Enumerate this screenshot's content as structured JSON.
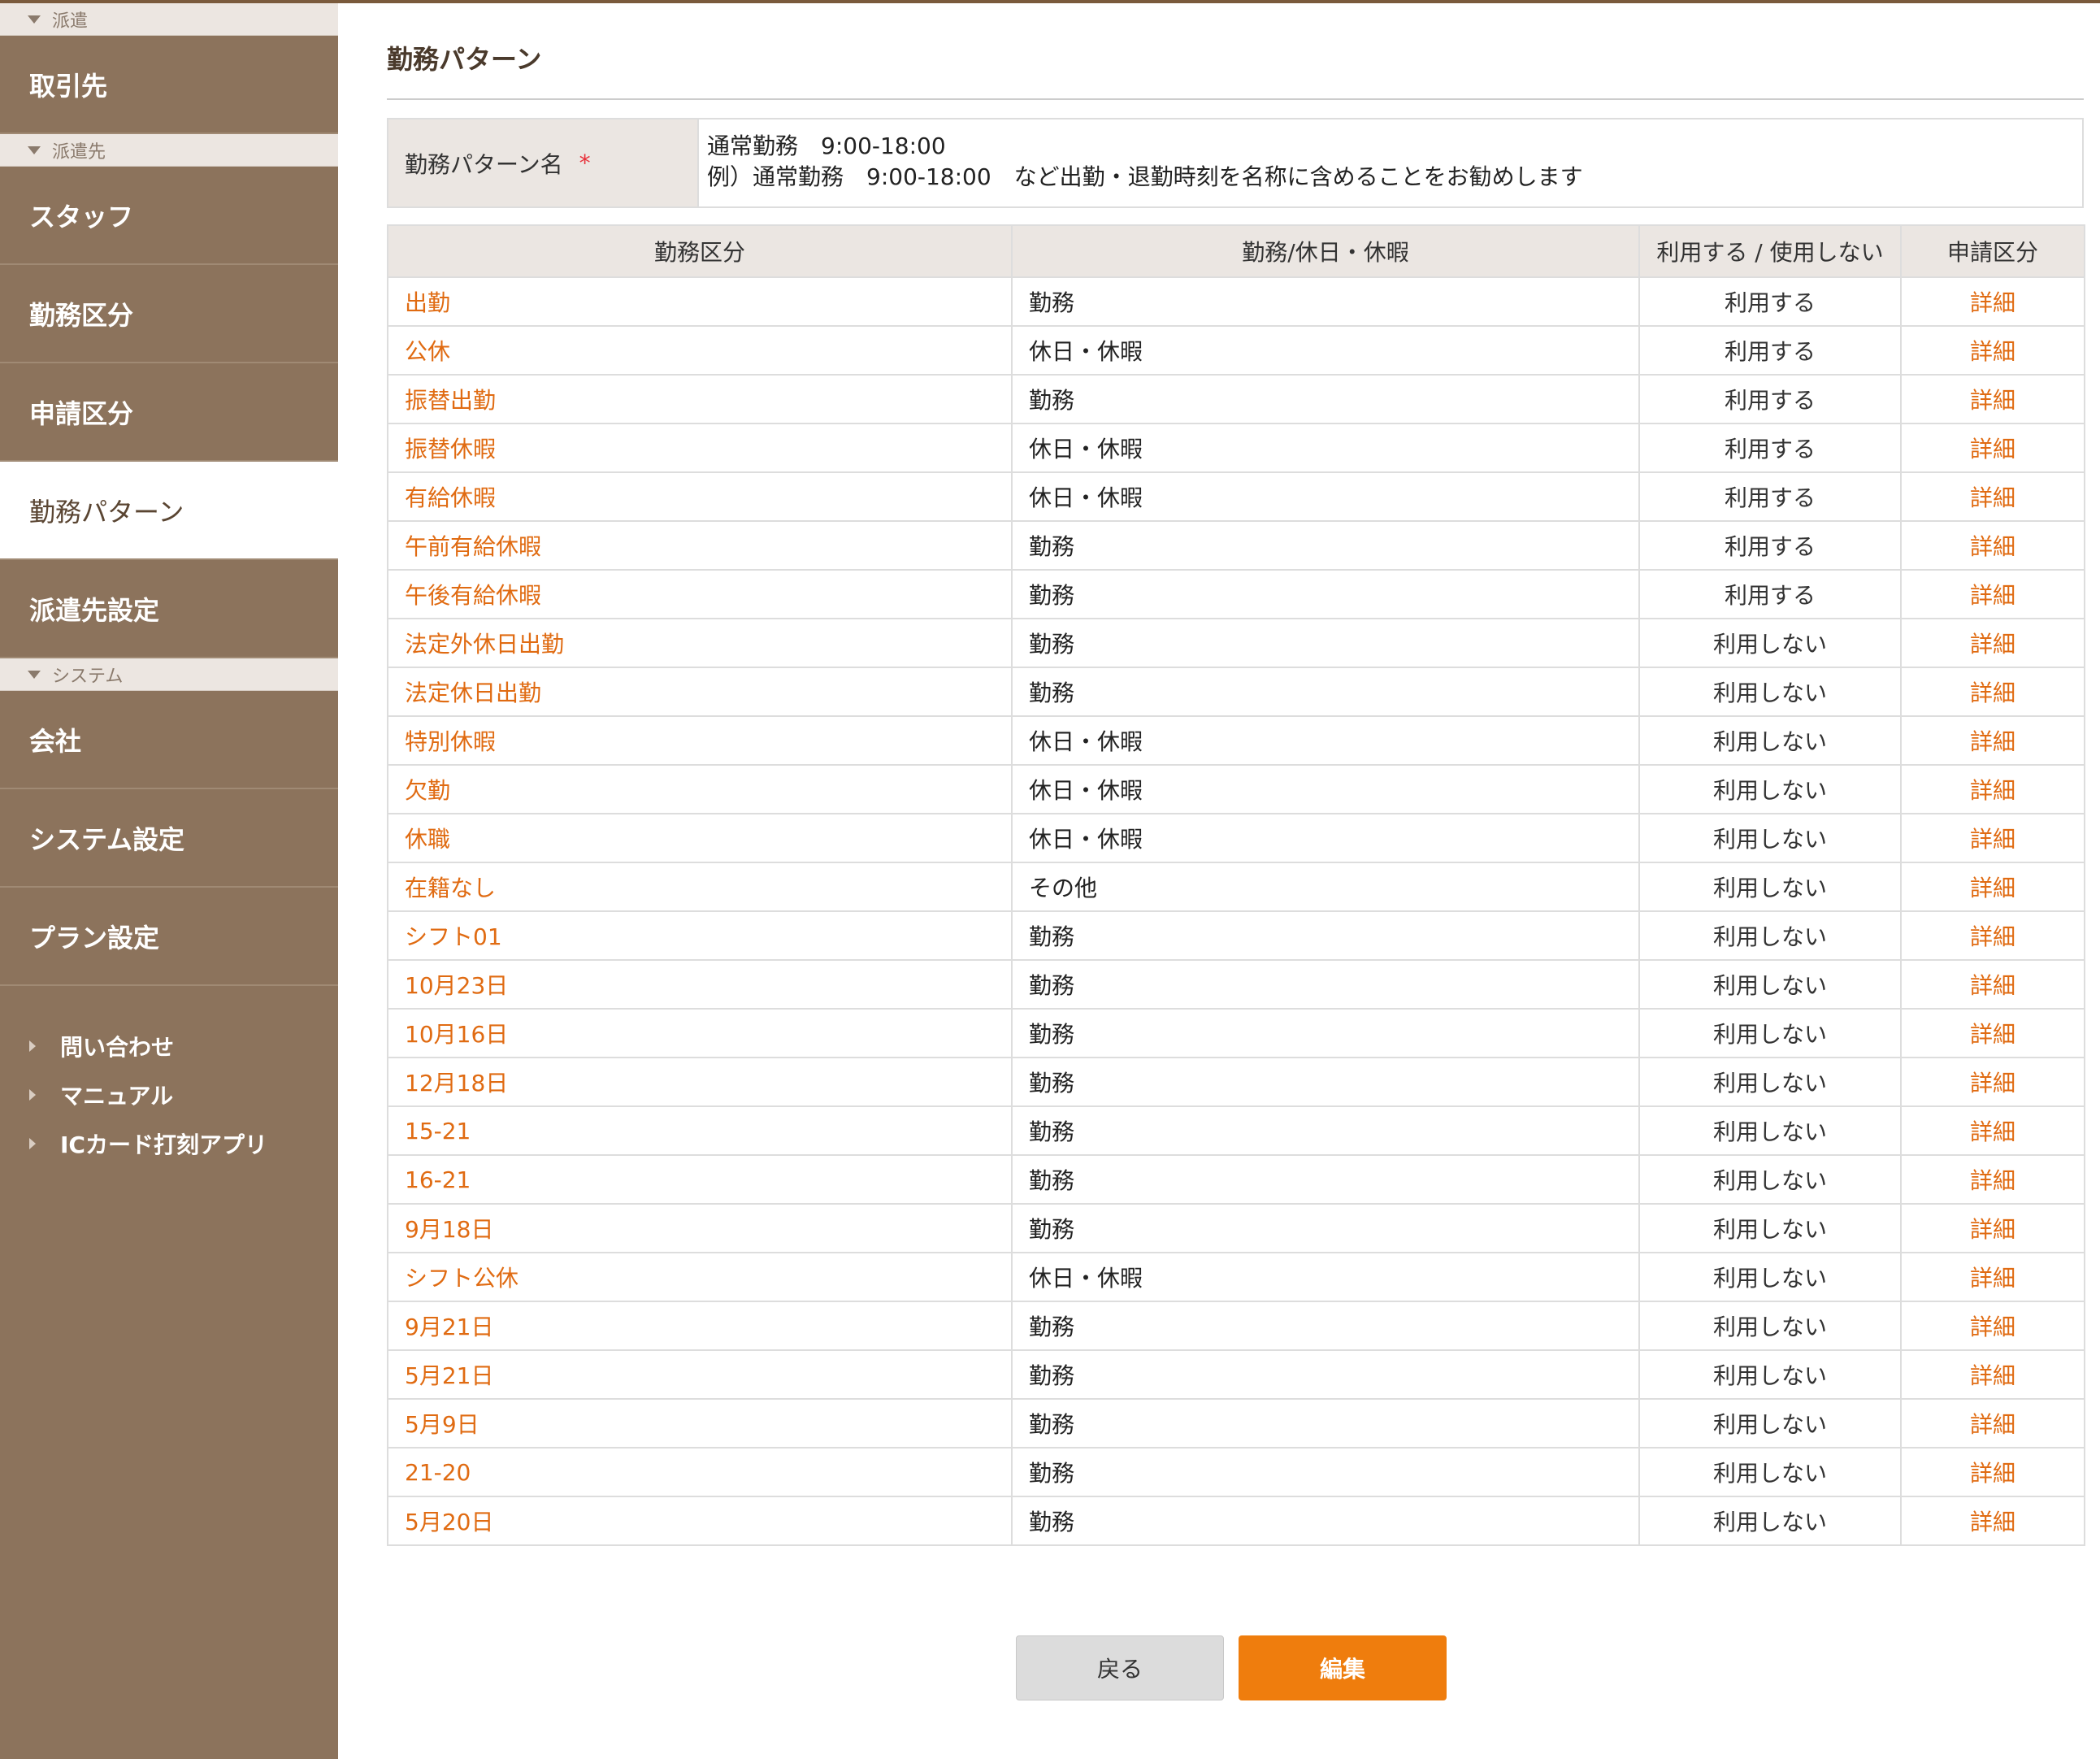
{
  "sidebar": {
    "sections": [
      {
        "header": "派遣",
        "items": [
          {
            "label": "取引先",
            "active": false
          }
        ]
      },
      {
        "header": "派遣先",
        "items": [
          {
            "label": "スタッフ",
            "active": false
          },
          {
            "label": "勤務区分",
            "active": false
          },
          {
            "label": "申請区分",
            "active": false
          },
          {
            "label": "勤務パターン",
            "active": true
          },
          {
            "label": "派遣先設定",
            "active": false
          }
        ]
      },
      {
        "header": "システム",
        "items": [
          {
            "label": "会社",
            "active": false
          },
          {
            "label": "システム設定",
            "active": false
          },
          {
            "label": "プラン設定",
            "active": false
          }
        ]
      }
    ],
    "links": [
      "問い合わせ",
      "マニュアル",
      "ICカード打刻アプリ"
    ]
  },
  "page": {
    "title": "勤務パターン",
    "name_field": {
      "label": "勤務パターン名",
      "required_mark": "*",
      "value": "通常勤務　9:00-18:00",
      "hint": "例）通常勤務　9:00-18:00　など出勤・退勤時刻を名称に含めることをお勧めします"
    },
    "table": {
      "headers": [
        "勤務区分",
        "勤務/休日・休暇",
        "利用する / 使用しない",
        "申請区分"
      ],
      "rows": [
        [
          "出勤",
          "勤務",
          "利用する",
          "詳細"
        ],
        [
          "公休",
          "休日・休暇",
          "利用する",
          "詳細"
        ],
        [
          "振替出勤",
          "勤務",
          "利用する",
          "詳細"
        ],
        [
          "振替休暇",
          "休日・休暇",
          "利用する",
          "詳細"
        ],
        [
          "有給休暇",
          "休日・休暇",
          "利用する",
          "詳細"
        ],
        [
          "午前有給休暇",
          "勤務",
          "利用する",
          "詳細"
        ],
        [
          "午後有給休暇",
          "勤務",
          "利用する",
          "詳細"
        ],
        [
          "法定外休日出勤",
          "勤務",
          "利用しない",
          "詳細"
        ],
        [
          "法定休日出勤",
          "勤務",
          "利用しない",
          "詳細"
        ],
        [
          "特別休暇",
          "休日・休暇",
          "利用しない",
          "詳細"
        ],
        [
          "欠勤",
          "休日・休暇",
          "利用しない",
          "詳細"
        ],
        [
          "休職",
          "休日・休暇",
          "利用しない",
          "詳細"
        ],
        [
          "在籍なし",
          "その他",
          "利用しない",
          "詳細"
        ],
        [
          "シフト01",
          "勤務",
          "利用しない",
          "詳細"
        ],
        [
          "10月23日",
          "勤務",
          "利用しない",
          "詳細"
        ],
        [
          "10月16日",
          "勤務",
          "利用しない",
          "詳細"
        ],
        [
          "12月18日",
          "勤務",
          "利用しない",
          "詳細"
        ],
        [
          "15-21",
          "勤務",
          "利用しない",
          "詳細"
        ],
        [
          "16-21",
          "勤務",
          "利用しない",
          "詳細"
        ],
        [
          "9月18日",
          "勤務",
          "利用しない",
          "詳細"
        ],
        [
          "シフト公休",
          "休日・休暇",
          "利用しない",
          "詳細"
        ],
        [
          "9月21日",
          "勤務",
          "利用しない",
          "詳細"
        ],
        [
          "5月21日",
          "勤務",
          "利用しない",
          "詳細"
        ],
        [
          "5月9日",
          "勤務",
          "利用しない",
          "詳細"
        ],
        [
          "21-20",
          "勤務",
          "利用しない",
          "詳細"
        ],
        [
          "5月20日",
          "勤務",
          "利用しない",
          "詳細"
        ]
      ]
    },
    "buttons": {
      "back": "戻る",
      "edit": "編集"
    }
  },
  "colors": {
    "sidebar_bg": "#8c735c",
    "accent_orange": "#ef7d0d",
    "link_orange": "#e06b12",
    "required_red": "#e8303a"
  }
}
